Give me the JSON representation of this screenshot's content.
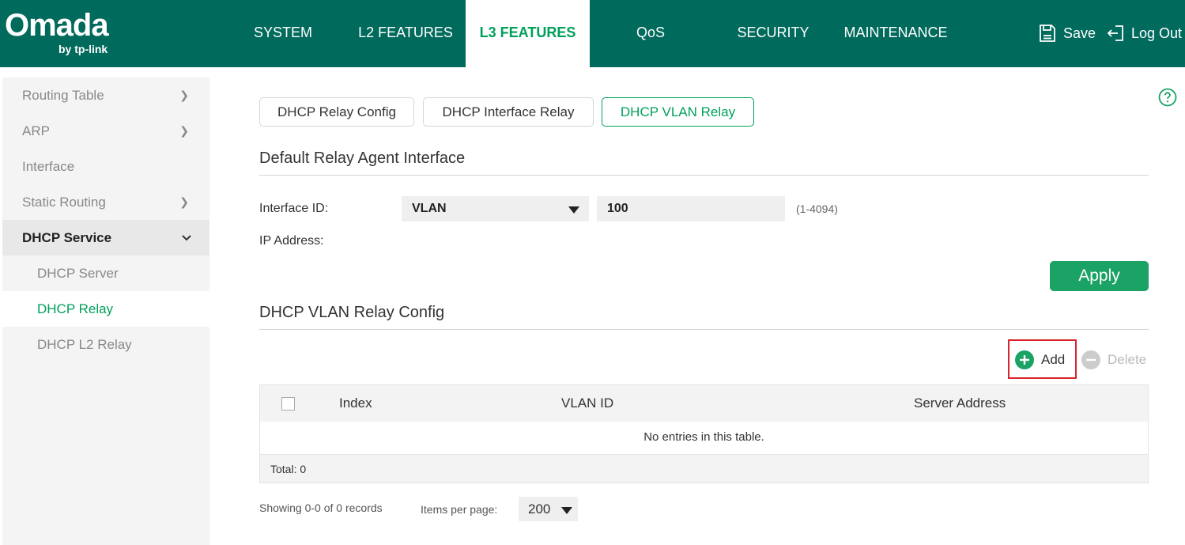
{
  "header": {
    "logo_main": "Omada",
    "logo_sub": "by tp-link",
    "nav": [
      "SYSTEM",
      "L2 FEATURES",
      "L3 FEATURES",
      "QoS",
      "SECURITY",
      "MAINTENANCE"
    ],
    "active_nav": "L3 FEATURES",
    "save_label": "Save",
    "logout_label": "Log Out"
  },
  "sidebar": {
    "items": [
      "Routing Table",
      "ARP",
      "Interface",
      "Static Routing",
      "DHCP Service"
    ],
    "subitems": [
      "DHCP Server",
      "DHCP Relay",
      "DHCP L2 Relay"
    ],
    "active_sub": "DHCP Relay"
  },
  "tabs": [
    "DHCP Relay Config",
    "DHCP Interface Relay",
    "DHCP VLAN Relay"
  ],
  "active_tab": "DHCP VLAN Relay",
  "default_relay": {
    "title": "Default Relay Agent Interface",
    "interface_id_label": "Interface ID:",
    "interface_type": "VLAN",
    "interface_value": "100",
    "range_hint": "(1-4094)",
    "ip_address_label": "IP Address:",
    "apply_label": "Apply"
  },
  "vlan_relay": {
    "title": "DHCP VLAN Relay Config",
    "add_label": "Add",
    "delete_label": "Delete",
    "columns": [
      "Index",
      "VLAN ID",
      "Server Address"
    ],
    "empty_text": "No entries in this table.",
    "total_text": "Total: 0"
  },
  "pager": {
    "info": "Showing 0-0 of 0 records",
    "per_page_label": "Items per page:",
    "per_page_value": "200"
  },
  "colors": {
    "header_bg": "#006a5c",
    "accent": "#00a05a",
    "apply_bg": "#1aa364",
    "highlight": "#d9242c"
  }
}
